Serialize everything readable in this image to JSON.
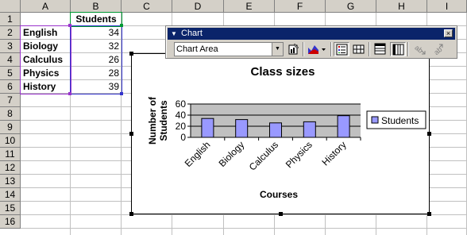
{
  "sheet": {
    "columns": [
      "A",
      "B",
      "C",
      "D",
      "E",
      "F",
      "G",
      "H",
      "I"
    ],
    "rows": [
      "1",
      "2",
      "3",
      "4",
      "5",
      "6",
      "7",
      "8",
      "9",
      "10",
      "11",
      "12",
      "13",
      "14",
      "15",
      "16"
    ],
    "header_cell": "Students",
    "courses": [
      "English",
      "Biology",
      "Calculus",
      "Physics",
      "History"
    ],
    "students": [
      "34",
      "32",
      "26",
      "28",
      "39"
    ]
  },
  "toolbar": {
    "title": "Chart",
    "close_label": "×",
    "selected_element": "Chart Area",
    "icons": [
      "format-chart-area-icon",
      "chart-type-icon",
      "legend-icon",
      "data-table-icon",
      "by-row-icon",
      "by-column-icon",
      "angle-text-downward-icon",
      "angle-text-upward-icon"
    ]
  },
  "chart_data": {
    "type": "bar",
    "title": "Class sizes",
    "xlabel": "Courses",
    "ylabel": "Number of Students",
    "categories": [
      "English",
      "Biology",
      "Calculus",
      "Physics",
      "History"
    ],
    "series": [
      {
        "name": "Students",
        "values": [
          34,
          32,
          26,
          28,
          39
        ]
      }
    ],
    "ylim": [
      0,
      60
    ],
    "yticks": [
      "0",
      "20",
      "40",
      "60"
    ],
    "grid": true,
    "legend": "right",
    "colors": {
      "bar": "#9999ff",
      "plot_area": "#c0c0c0",
      "border": "#000000"
    }
  }
}
